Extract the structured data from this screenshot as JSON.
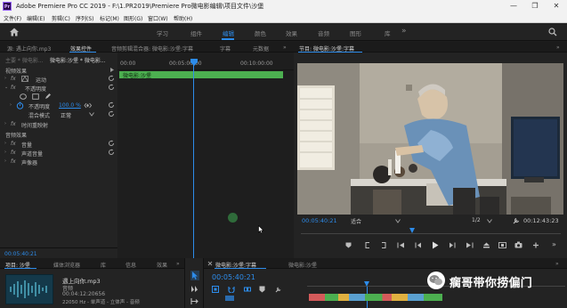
{
  "window": {
    "title": "Adobe Premiere Pro CC 2019 - F:\\1.PR2019\\Premiere Pro微电影编辑\\项目文件\\沙堡",
    "app_logo": "Pr",
    "controls": [
      "—",
      "❐",
      "✕"
    ]
  },
  "menu": [
    "文件(F)",
    "编辑(E)",
    "剪辑(C)",
    "序列(S)",
    "标记(M)",
    "图形(G)",
    "窗口(W)",
    "帮助(H)"
  ],
  "workspaces": {
    "tabs": [
      "学习",
      "组件",
      "编辑",
      "颜色",
      "效果",
      "音频",
      "图形",
      "库"
    ],
    "active": "编辑",
    "more": "»"
  },
  "effect_panel": {
    "tabs": [
      "源: 遇上向你.mp3",
      "效果控件",
      "音频剪辑混合器: 微电影:沙堡:字幕",
      "字幕",
      "元数据"
    ],
    "active_tab": "效果控件",
    "more": "»",
    "master_label": "主要 * 微电影...",
    "clip_label": "微电影:沙堡 * 微电影...",
    "section_video": "视频效果",
    "motion": "运动",
    "opacity": "不透明度",
    "opacity_prop": "不透明度",
    "opacity_value": "100.0 %",
    "blend_mode_label": "混合模式",
    "blend_mode_value": "正常",
    "time_remap": "时间重映射",
    "section_audio": "音频效果",
    "volume": "音量",
    "channel_volume": "声道音量",
    "panner": "声像器",
    "timecode": "00:05:40:21",
    "ruler": [
      "00:00",
      "00:05:00:00",
      "00:10:00:00"
    ],
    "clip_bar_label": "微电影:沙堡"
  },
  "program_panel": {
    "title": "节目: 微电影:沙堡:字幕",
    "more": "»",
    "timecode": "00:05:40:21",
    "fit_label": "适合",
    "resolution": "1/2",
    "duration": "00:12:43:23"
  },
  "project_panel": {
    "tabs": [
      "项目: 沙堡",
      "媒体浏览器",
      "库",
      "信息",
      "效果"
    ],
    "more": "»",
    "file_name": "遇上向你.mp3",
    "file_type": "音频",
    "file_duration": "00:04:12:20656",
    "file_info": "22050 Hz - 单声道 - 立体声 - 音频"
  },
  "timeline_panel": {
    "tabs": [
      "微电影:沙堡:字幕",
      "微电影:沙堡"
    ],
    "active_tab": "微电影:沙堡:字幕",
    "more": "»",
    "timecode": "00:05:40:21"
  },
  "watermark": "瘸哥带你捞偏门",
  "colors": {
    "accent": "#2d8ceb",
    "clip_green": "#4caf50",
    "panel_bg": "#232323"
  }
}
